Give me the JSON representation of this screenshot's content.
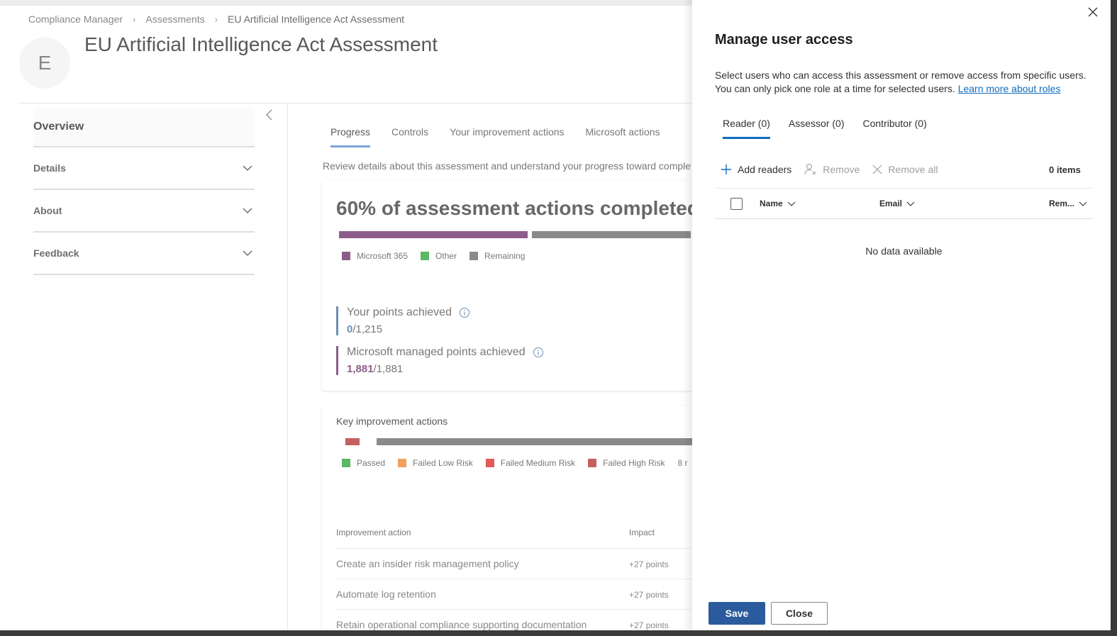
{
  "breadcrumb": {
    "items": [
      "Compliance Manager",
      "Assessments",
      "EU Artificial Intelligence Act Assessment"
    ]
  },
  "page": {
    "avatar_letter": "E",
    "title": "EU Artificial Intelligence Act Assessment"
  },
  "leftnav": {
    "overview": "Overview",
    "items": [
      {
        "label": "Details"
      },
      {
        "label": "About"
      },
      {
        "label": "Feedback"
      }
    ]
  },
  "tabs": [
    "Progress",
    "Controls",
    "Your improvement actions",
    "Microsoft actions"
  ],
  "review_text": "Review details about this assessment and understand your progress toward completion",
  "progress_card": {
    "title": "60% of assessment actions completed",
    "completed_fraction": 0.6,
    "legend": [
      {
        "label": "Microsoft 365",
        "color": "#8c5d8a"
      },
      {
        "label": "Other",
        "color": "#5bb864"
      },
      {
        "label": "Remaining",
        "color": "#8a8a8a"
      }
    ],
    "your_points": {
      "label": "Your points achieved",
      "achieved": "0",
      "total": "/1,215",
      "color": "#6d8fb3"
    },
    "ms_points": {
      "label": "Microsoft managed points achieved",
      "achieved": "1,881",
      "total": "/1,881",
      "color": "#8c5d8a"
    }
  },
  "key_actions": {
    "title": "Key improvement actions",
    "legend": [
      {
        "label": "Passed",
        "color": "#5bb864"
      },
      {
        "label": "Failed Low Risk",
        "color": "#f2a05c"
      },
      {
        "label": "Failed Medium Risk",
        "color": "#e05a5a"
      },
      {
        "label": "Failed High Risk",
        "color": "#c46060"
      },
      {
        "label": "8 r",
        "color": ""
      }
    ],
    "columns": [
      "Improvement action",
      "Impact"
    ],
    "rows": [
      {
        "action": "Create an insider risk management policy",
        "impact": "+27 points"
      },
      {
        "action": "Automate log retention",
        "impact": "+27 points"
      },
      {
        "action": "Retain operational compliance supporting documentation",
        "impact": "+27 points"
      }
    ]
  },
  "panel": {
    "title": "Manage user access",
    "description_line1": "Select users who can access this assessment or remove access from specific users.",
    "description_line2": "You can only pick one role at a time for selected users.",
    "learn_more": "Learn more about roles",
    "tabs": [
      "Reader (0)",
      "Assessor (0)",
      "Contributor (0)"
    ],
    "commands": {
      "add": "Add readers",
      "remove": "Remove",
      "remove_all": "Remove all"
    },
    "items_count": "0 items",
    "columns": [
      "Name",
      "Email",
      "Rem..."
    ],
    "empty_text": "No data available",
    "save_label": "Save",
    "close_label": "Close"
  },
  "colors": {
    "accent": "#0f6cbd",
    "save_button": "#2b5b9c"
  }
}
